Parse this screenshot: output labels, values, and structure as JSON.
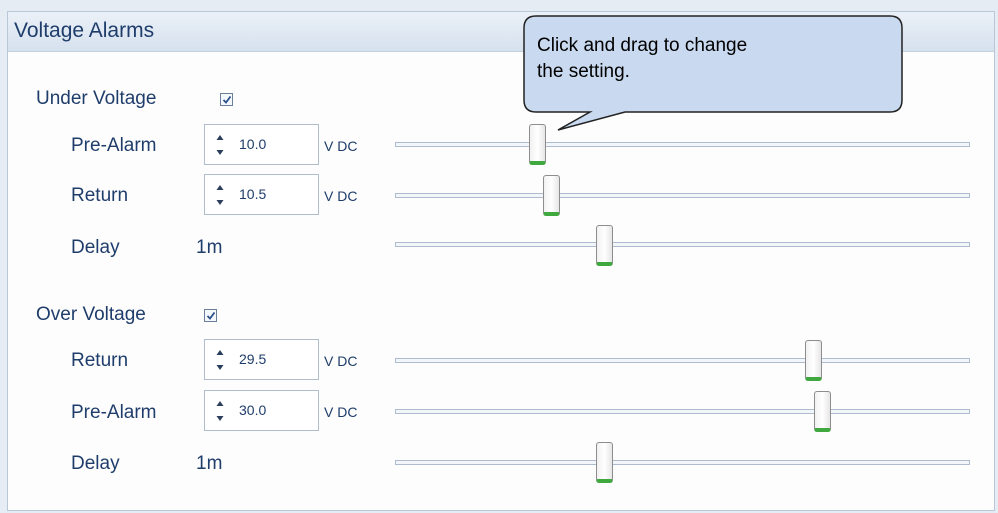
{
  "panel": {
    "title": "Voltage Alarms"
  },
  "tooltip": {
    "line1": "Click and drag to change",
    "line2": "the setting."
  },
  "under_voltage": {
    "label": "Under Voltage",
    "checked": true,
    "rows": [
      {
        "label": "Pre-Alarm",
        "value": "10.0",
        "unit": "V DC",
        "slider_level": 0.24
      },
      {
        "label": "Return",
        "value": "10.5",
        "unit": "V DC",
        "slider_level": 0.265
      },
      {
        "label": "Delay",
        "value": "1m",
        "slider_level": 0.36
      }
    ]
  },
  "over_voltage": {
    "label": "Over Voltage",
    "checked": true,
    "rows": [
      {
        "label": "Return",
        "value": "29.5",
        "unit": "V DC",
        "slider_level": 0.735
      },
      {
        "label": "Pre-Alarm",
        "value": "30.0",
        "unit": "V DC",
        "slider_level": 0.75
      },
      {
        "label": "Delay",
        "value": "1m",
        "slider_level": 0.36
      }
    ]
  },
  "colors": {
    "text": "#1f3d6b",
    "thumb_accent": "#3fa83f",
    "tooltip_fill": "#c9d9ef"
  },
  "icons": [
    "checkbox-check-icon",
    "spinner-up-arrow-icon",
    "spinner-down-arrow-icon"
  ]
}
